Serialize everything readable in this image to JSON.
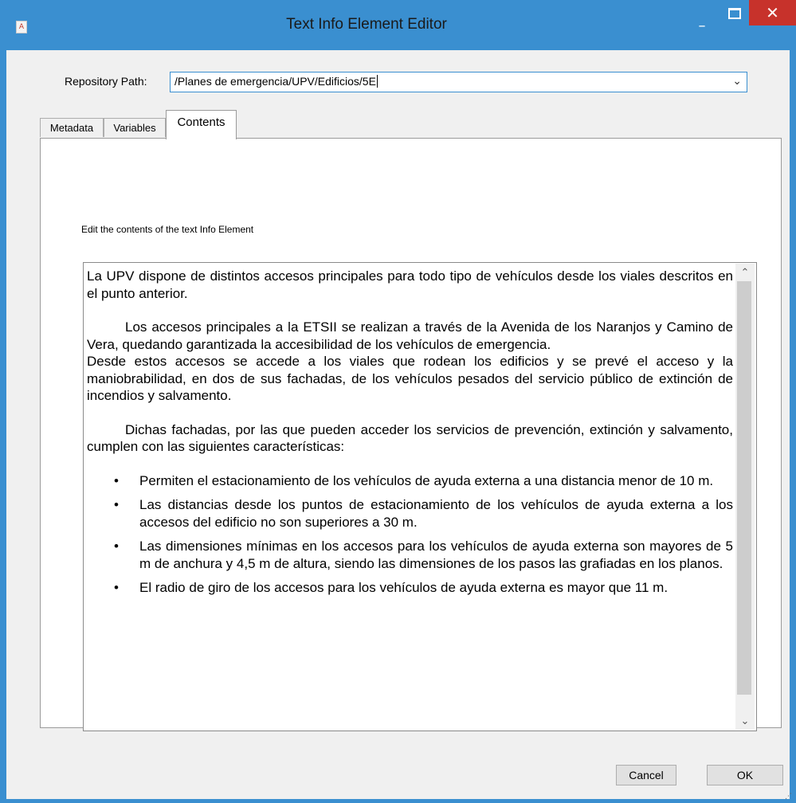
{
  "window": {
    "title": "Text Info Element Editor",
    "minimize_symbol": "–",
    "close_symbol": "✕",
    "app_icon_glyph": "A"
  },
  "repository": {
    "label": "Repository Path:",
    "value": "/Planes de emergencia/UPV/Edificios/5E",
    "dropdown_arrow": "⌄"
  },
  "tabs": [
    {
      "label": "Metadata",
      "selected": false
    },
    {
      "label": "Variables",
      "selected": false
    },
    {
      "label": "Contents",
      "selected": true
    }
  ],
  "contents": {
    "caption": "Edit the contents of the text Info Element",
    "paragraphs": [
      "La UPV dispone de distintos accesos principales para todo tipo de vehículos desde los viales descritos en el punto anterior.",
      "Los accesos principales a la ETSII se realizan a través de la Avenida de los Naranjos y Camino de Vera, quedando garantizada la accesibilidad de los vehículos de emergencia.",
      "Desde estos accesos se accede a los viales que rodean los edificios y se prevé el acceso y la maniobrabilidad, en dos de sus fachadas, de los vehículos pesados del servicio público de extinción de incendios y salvamento.",
      "Dichas fachadas, por las que pueden acceder los servicios de prevención, extinción y salvamento, cumplen con las siguientes características:"
    ],
    "bullets": [
      "Permiten el estacionamiento de los vehículos de ayuda externa a una distancia menor de 10 m.",
      "Las distancias desde los puntos de estacionamiento de los vehículos de ayuda externa a los accesos del edificio no son superiores a 30 m.",
      "Las dimensiones mínimas en los accesos para los vehículos de ayuda externa son mayores de 5 m de anchura y 4,5 m de altura, siendo las dimensiones de los pasos las grafiadas en los planos.",
      "El radio de giro de los accesos para los vehículos de ayuda externa es mayor que 11 m."
    ],
    "bullet_symbol": "•"
  },
  "scrollbar": {
    "up_arrow": "⌃",
    "down_arrow": "⌄"
  },
  "buttons": {
    "cancel": "Cancel",
    "ok": "OK"
  },
  "colors": {
    "title_bar": "#3a8fd0",
    "close_button": "#c7322b",
    "client_area": "#f0f0f0"
  }
}
